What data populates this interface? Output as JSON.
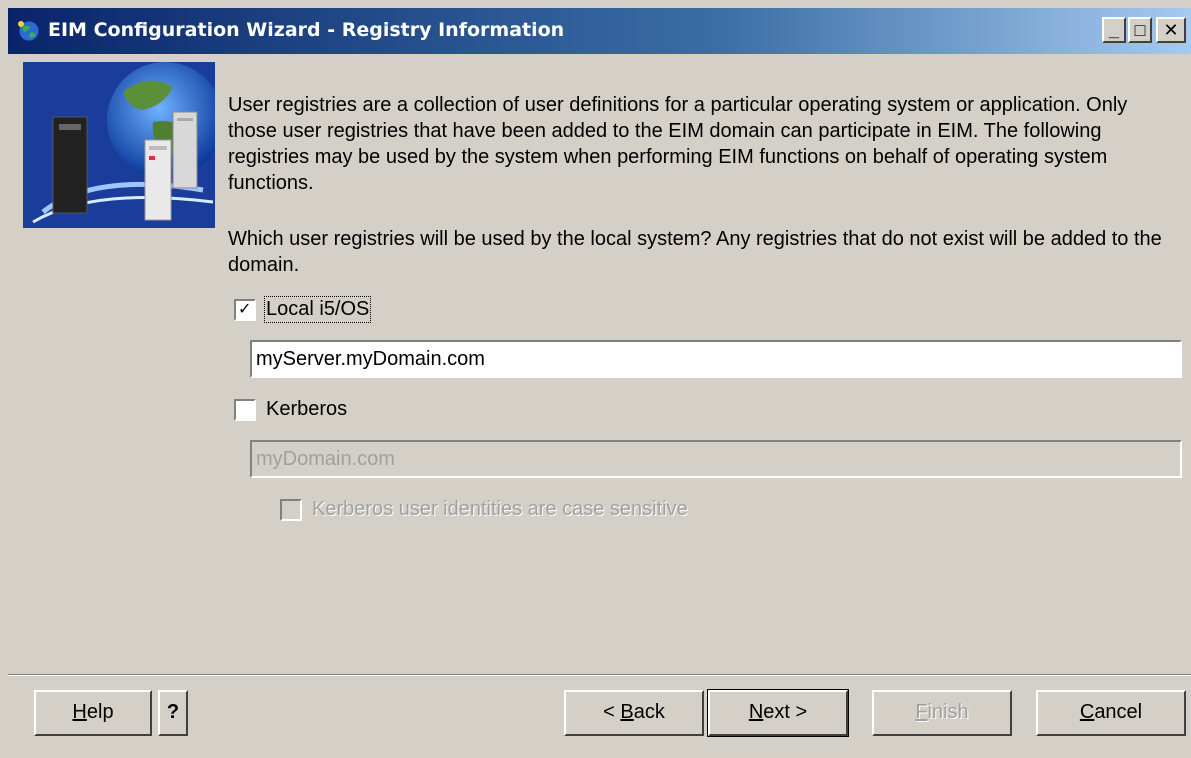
{
  "window": {
    "title": "EIM Configuration Wizard - Registry Information",
    "controls": {
      "minimize": "_",
      "maximize": "□",
      "close": "✕"
    }
  },
  "intro": {
    "paragraph": "User registries are a collection of user definitions for a particular operating system or application.  Only those user registries that have been added to the EIM domain can participate in EIM.  The following registries may be used by the system when performing EIM functions on behalf of operating system functions.",
    "question": "Which user registries will be used by the local system?  Any registries that do not exist will be added to the domain."
  },
  "registries": {
    "local": {
      "label": "Local i5/OS",
      "checked": true,
      "value": "myServer.myDomain.com"
    },
    "kerberos": {
      "label": "Kerberos",
      "checked": false,
      "value": "myDomain.com",
      "case_sensitive_label": "Kerberos user identities are case sensitive",
      "case_sensitive_checked": false
    }
  },
  "buttons": {
    "help": {
      "accel": "H",
      "rest": "elp"
    },
    "help_question": "?",
    "back": {
      "prefix": "< ",
      "accel": "B",
      "rest": "ack"
    },
    "next": {
      "accel": "N",
      "rest": "ext >"
    },
    "finish": {
      "accel": "F",
      "rest": "inish"
    },
    "cancel": {
      "accel": "C",
      "rest": "ancel"
    }
  },
  "icons": [
    "wizard-globe-icon",
    "server-banner-image",
    "question-icon",
    "minimize-icon",
    "maximize-icon",
    "close-icon"
  ]
}
